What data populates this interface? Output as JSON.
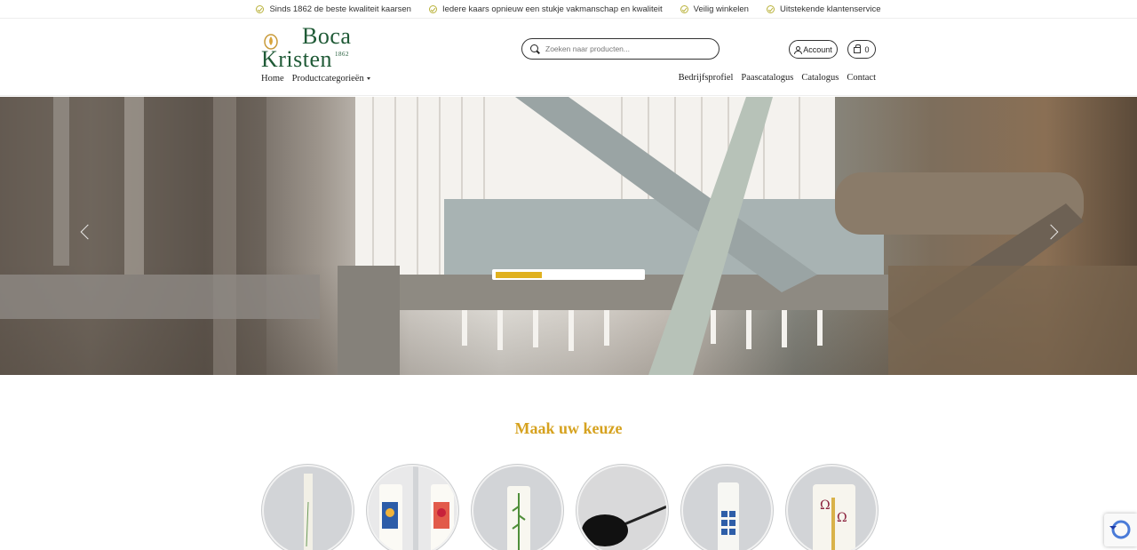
{
  "usp": [
    {
      "text": "Sinds 1862 de beste kwaliteit kaarsen"
    },
    {
      "text": "Iedere kaars opnieuw een stukje vakmanschap en kwaliteit"
    },
    {
      "text": "Veilig winkelen"
    },
    {
      "text": "Uitstekende klantenservice"
    }
  ],
  "logo": {
    "line1": "Boca",
    "line2": "Kristen",
    "year": "1862"
  },
  "search": {
    "placeholder": "Zoeken naar producten..."
  },
  "header": {
    "account_label": "Account",
    "cart_count": "0"
  },
  "nav_left": {
    "home": "Home",
    "categories": "Productcategorieën"
  },
  "nav_right": [
    "Bedrijfsprofiel",
    "Paascatalogus",
    "Catalogus",
    "Contact"
  ],
  "section": {
    "title": "Maak uw keuze"
  },
  "colors": {
    "accent": "#d6a21f",
    "brand_green": "#1f5a36",
    "check": "#b9b23a"
  },
  "categories": [
    {
      "icon": "tall-candle"
    },
    {
      "icon": "two-candles"
    },
    {
      "icon": "green-vine-candle"
    },
    {
      "icon": "candle-brush"
    },
    {
      "icon": "blue-cross-candle"
    },
    {
      "icon": "alpha-omega-candle"
    }
  ]
}
